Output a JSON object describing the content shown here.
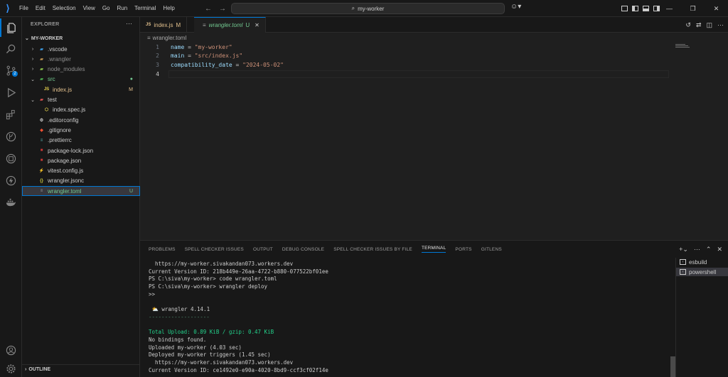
{
  "titlebar": {
    "menu": [
      "File",
      "Edit",
      "Selection",
      "View",
      "Go",
      "Run",
      "Terminal",
      "Help"
    ],
    "search_text": "my-worker"
  },
  "activity_bar": {
    "scm_badge": "2"
  },
  "sidebar": {
    "title": "EXPLORER",
    "workspace": "MY-WORKER",
    "outline": "OUTLINE",
    "tree": [
      {
        "label": ".vscode",
        "type": "folder",
        "chevron": "›",
        "icon": "folder-vscode-icon",
        "color": "#cccccc",
        "status": ""
      },
      {
        "label": ".wrangler",
        "type": "folder",
        "chevron": "›",
        "icon": "folder-icon",
        "color": "#8c8c8c",
        "status": ""
      },
      {
        "label": "node_modules",
        "type": "folder",
        "chevron": "›",
        "icon": "folder-node-icon",
        "color": "#8c8c8c",
        "status": ""
      },
      {
        "label": "src",
        "type": "folder",
        "chevron": "⌄",
        "icon": "folder-src-icon",
        "color": "#73c991",
        "status": "●"
      },
      {
        "label": "index.js",
        "type": "file",
        "chevron": "",
        "icon": "js-file-icon",
        "color": "#e2c08d",
        "status": "M"
      },
      {
        "label": "test",
        "type": "folder",
        "chevron": "⌄",
        "icon": "folder-test-icon",
        "color": "#cccccc",
        "status": ""
      },
      {
        "label": "index.spec.js",
        "type": "file",
        "chevron": "",
        "icon": "test-js-icon",
        "color": "#cccccc",
        "status": ""
      },
      {
        "label": ".editorconfig",
        "type": "file",
        "chevron": "",
        "icon": "editorconfig-icon",
        "color": "#cccccc",
        "status": ""
      },
      {
        "label": ".gitignore",
        "type": "file",
        "chevron": "",
        "icon": "git-icon",
        "color": "#cccccc",
        "status": ""
      },
      {
        "label": ".prettierrc",
        "type": "file",
        "chevron": "",
        "icon": "prettier-icon",
        "color": "#cccccc",
        "status": ""
      },
      {
        "label": "package-lock.json",
        "type": "file",
        "chevron": "",
        "icon": "npm-icon",
        "color": "#cccccc",
        "status": ""
      },
      {
        "label": "package.json",
        "type": "file",
        "chevron": "",
        "icon": "npm-icon",
        "color": "#cccccc",
        "status": ""
      },
      {
        "label": "vitest.config.js",
        "type": "file",
        "chevron": "",
        "icon": "vitest-icon",
        "color": "#cccccc",
        "status": ""
      },
      {
        "label": "wrangler.jsonc",
        "type": "file",
        "chevron": "",
        "icon": "json-icon",
        "color": "#cccccc",
        "status": ""
      },
      {
        "label": "wrangler.toml",
        "type": "file",
        "chevron": "",
        "icon": "toml-icon",
        "color": "#73c991",
        "status": "U"
      }
    ]
  },
  "tabs": [
    {
      "label": "index.js",
      "status": "M",
      "lang": "JS",
      "active": false
    },
    {
      "label": "wrangler.toml",
      "status": "U",
      "lang": "",
      "active": true
    }
  ],
  "breadcrumb": "wrangler.toml",
  "editor": {
    "lines": [
      {
        "n": "1",
        "key": "name",
        "value": "\"my-worker\""
      },
      {
        "n": "2",
        "key": "main",
        "value": "\"src/index.js\""
      },
      {
        "n": "3",
        "key": "compatibility_date",
        "value": "\"2024-05-02\""
      },
      {
        "n": "4",
        "key": "",
        "value": ""
      }
    ]
  },
  "panel": {
    "tabs": [
      "PROBLEMS",
      "SPELL CHECKER ISSUES",
      "OUTPUT",
      "DEBUG CONSOLE",
      "SPELL CHECKER ISSUES BY FILE",
      "TERMINAL",
      "PORTS",
      "GITLENS"
    ],
    "active_tab": "TERMINAL",
    "terminals": [
      "esbuild",
      "powershell"
    ],
    "active_terminal": "powershell",
    "terminal_lines": [
      {
        "text": "  https://my-worker.sivakandan073.workers.dev",
        "style": ""
      },
      {
        "text": "Current Version ID: 218b449e-26aa-4722-b880-077522bf01ee",
        "style": ""
      },
      {
        "text": "PS C:\\siva\\my-worker> code wrangler.toml",
        "style": ""
      },
      {
        "text": "PS C:\\siva\\my-worker> wrangler deploy",
        "style": ""
      },
      {
        "text": ">>",
        "style": ""
      },
      {
        "text": "",
        "style": ""
      },
      {
        "text": " ⛅ wrangler 4.14.1",
        "style": ""
      },
      {
        "text": "-------------------",
        "style": "dim"
      },
      {
        "text": "",
        "style": ""
      },
      {
        "text": "Total Upload: 0.89 KiB / gzip: 0.47 KiB",
        "style": "mixed"
      },
      {
        "text": "No bindings found.",
        "style": ""
      },
      {
        "text": "Uploaded my-worker (4.03 sec)",
        "style": ""
      },
      {
        "text": "Deployed my-worker triggers (1.45 sec)",
        "style": ""
      },
      {
        "text": "  https://my-worker.sivakandan073.workers.dev",
        "style": ""
      },
      {
        "text": "Current Version ID: ce1492e0-e90a-4020-8bd9-ccf3cf02f14e",
        "style": ""
      }
    ]
  },
  "colors": {
    "accent": "#0078d4",
    "untracked": "#73c991",
    "modified": "#e2c08d",
    "string": "#ce9178"
  }
}
